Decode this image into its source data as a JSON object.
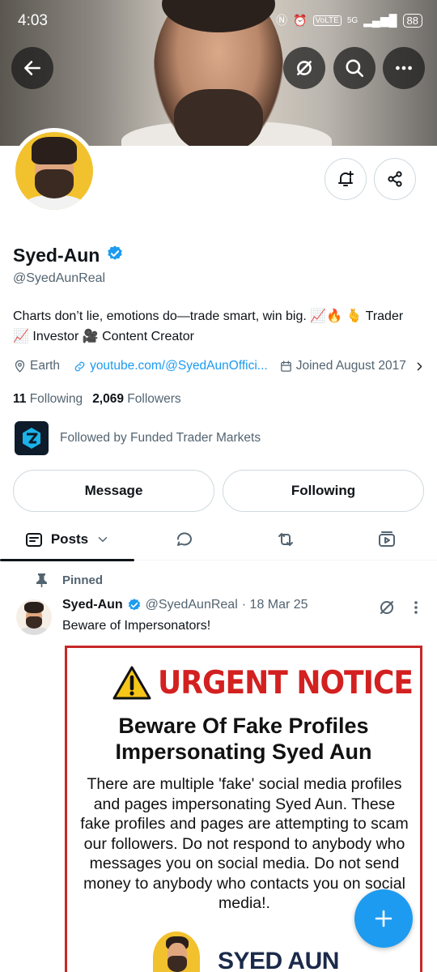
{
  "status_bar": {
    "time": "4:03",
    "network": "5G",
    "volte": "VoLTE",
    "battery": "88"
  },
  "profile": {
    "name": "Syed-Aun",
    "handle": "@SyedAunReal",
    "bio": "Charts don’t lie, emotions do—trade smart, win big. 📈🔥 🫰 Trader 📈 Investor 🎥 Content Creator",
    "location": "Earth",
    "link": "youtube.com/@SyedAunOffici...",
    "joined": "Joined August 2017",
    "following_count": "11",
    "following_label": "Following",
    "followers_count": "2,069",
    "followers_label": "Followers",
    "followed_by": "Followed by Funded Trader Markets"
  },
  "buttons": {
    "message": "Message",
    "following": "Following"
  },
  "tabs": {
    "posts": "Posts"
  },
  "post": {
    "pinned_label": "Pinned",
    "author_name": "Syed-Aun",
    "author_handle": "@SyedAunReal",
    "date": "· 18 Mar 25",
    "text": "Beware of Impersonators!",
    "image": {
      "urgent": "URGENT NOTICE",
      "title": "Beware Of Fake Profiles Impersonating Syed Aun",
      "body": "There are multiple 'fake' social media profiles and pages impersonating Syed Aun. These fake profiles and pages are attempting to scam our followers. Do not respond to anybody who messages you on social media. Do not send money to anybody who contacts you on social media!.",
      "logo_text": "SYED AUN"
    }
  },
  "colors": {
    "accent": "#1d9bf0",
    "urgent": "#d32020",
    "muted": "#536471"
  },
  "icons": [
    "back-arrow-icon",
    "grok-icon",
    "search-icon",
    "more-icon",
    "notification-bell-icon",
    "share-icon",
    "verified-icon",
    "location-icon",
    "link-icon",
    "calendar-icon",
    "chevron-right-icon",
    "posts-icon",
    "reply-icon",
    "repost-icon",
    "media-icon",
    "pin-icon",
    "plus-icon"
  ]
}
